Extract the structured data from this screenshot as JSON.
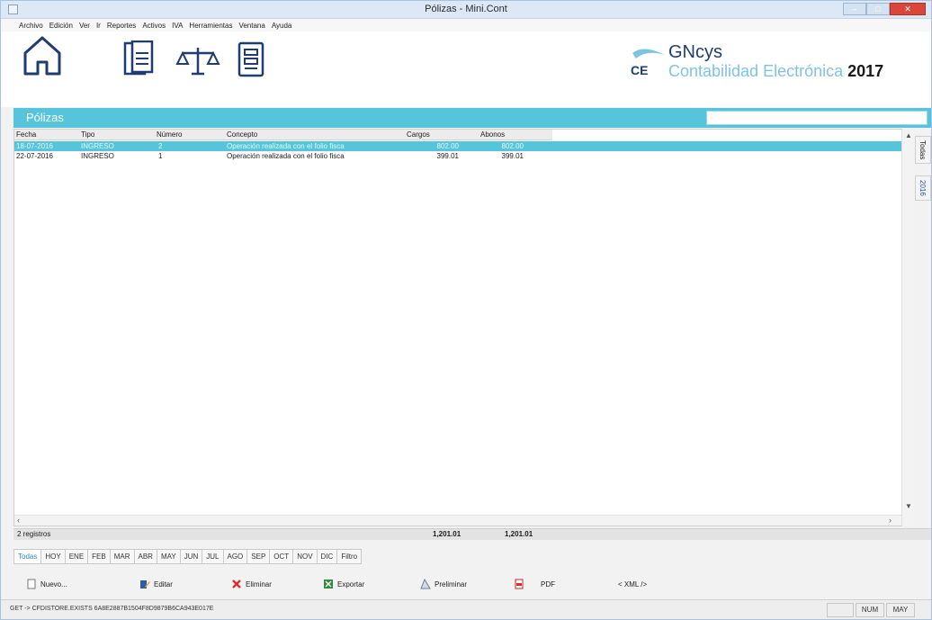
{
  "window": {
    "title": "Pólizas - Mini.Cont"
  },
  "menu": [
    "Archivo",
    "Edición",
    "Ver",
    "Ir",
    "Reportes",
    "Activos",
    "IVA",
    "Herramientas",
    "Ventana",
    "Ayuda"
  ],
  "brand": {
    "name": "GNcys",
    "mark": "CE",
    "subtitle": "Contabilidad Electrónica",
    "year": "2017"
  },
  "section": {
    "title": "Pólizas",
    "search_value": ""
  },
  "table": {
    "columns": [
      "Fecha",
      "Tipo",
      "Número",
      "Concepto",
      "Cargos",
      "Abonos"
    ],
    "rows": [
      {
        "fecha": "18-07-2016",
        "tipo": "INGRESO",
        "numero": "2",
        "concepto": "Operación realizada con el folio fisca",
        "cargos": "802.00",
        "abonos": "802.00",
        "selected": true
      },
      {
        "fecha": "22-07-2016",
        "tipo": "INGRESO",
        "numero": "1",
        "concepto": "Operación realizada con el folio fisca",
        "cargos": "399.01",
        "abonos": "399.01",
        "selected": false
      }
    ]
  },
  "side_tabs": [
    "Todas",
    "2016"
  ],
  "totals": {
    "count_label": "2 registros",
    "cargos": "1,201.01",
    "abonos": "1,201.01"
  },
  "month_tabs": [
    "Todas",
    "HOY",
    "ENE",
    "FEB",
    "MAR",
    "ABR",
    "MAY",
    "JUN",
    "JUL",
    "AGO",
    "SEP",
    "OCT",
    "NOV",
    "DIC",
    "Filtro"
  ],
  "actions": {
    "nuevo": "Nuevo...",
    "editar": "Editar",
    "eliminar": "Eliminar",
    "exportar": "Exportar",
    "preliminar": "Preliminar",
    "pdf": "PDF",
    "xml": "< XML />"
  },
  "status": {
    "text": "GET -> CFDISTORE.EXISTS 6A8E2887B1504F8D9879B6CA943E017E",
    "num": "NUM",
    "may": "MAY"
  },
  "colors": {
    "accent": "#56c5db",
    "brand_dark": "#1f3d6e",
    "brand_light": "#7fc3e3",
    "close": "#d9463a"
  }
}
